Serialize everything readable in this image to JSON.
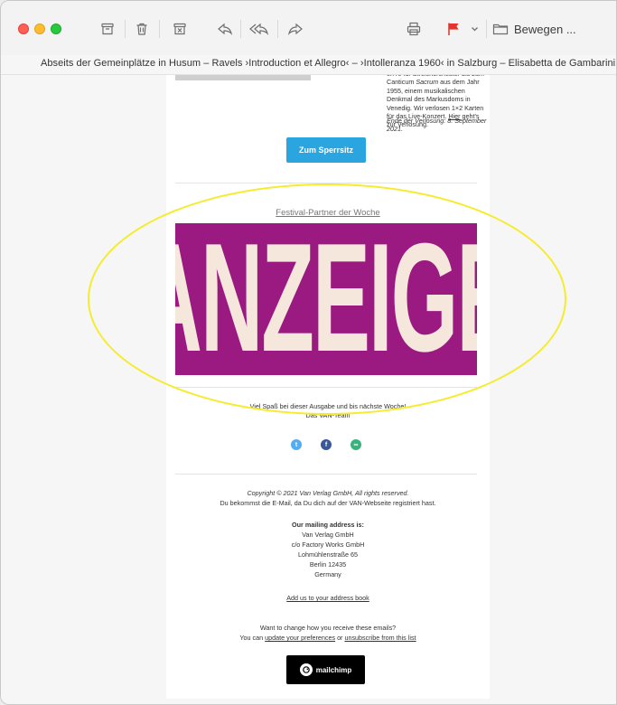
{
  "toolbar": {
    "move_label": "Bewegen ..."
  },
  "subject": "Abseits der Gemeinplätze in Husum – Ravels ›Introduction et Allegro‹ – ›Intolleranza 1960‹ in Salzburg – Elisabetta de Gambarini — Alle",
  "email": {
    "top_text_line1": "en ré für Streichorchester bis zum Canticum",
    "top_text_sacrum": "Sacrum",
    "top_text_line2": "aus dem Jahr 1955, einem musikalischen Denkmal des Markusdoms in Venedig. Wir verlosen 1×2 Karten für das Live-Konzert.",
    "top_text_link": "Hier",
    "top_text_line3": "geht's zur Verlosung.",
    "end_date": "Ende der Verlosung: 8. September 2021.",
    "cta_label": "Zum Sperrsitz",
    "partner_title": "Festival-Partner der Woche",
    "ad_text": "ANZEIGE",
    "greeting": "Viel Spaß bei dieser Ausgabe und bis nächste Woche!",
    "signature": "Das VAN-Team",
    "copyright": "Copyright © 2021 Van Verlag GmbH, All rights reserved.",
    "reason": "Du bekommst die E-Mail, da Du dich auf der VAN-Webseite registriert hast.",
    "address_heading": "Our mailing address is:",
    "address_lines": [
      "Van Verlag GmbH",
      "c/o Factory Works GmbH",
      "Lohmühlenstraße 65",
      "Berlin 12435",
      "Germany"
    ],
    "add_address_book": "Add us to your address book",
    "change_prompt": "Want to change how you receive these emails?",
    "you_can": "You can",
    "update_prefs": "update your preferences",
    "or": "or",
    "unsubscribe": "unsubscribe from this list",
    "mailchimp_label": "mailchimp"
  },
  "colors": {
    "cta": "#2aa5e0",
    "ad_background": "#9b1a82",
    "ad_text": "#f5e7db",
    "annotation": "#f4ec2c",
    "flag": "#e8322c"
  },
  "icons": [
    "archive-icon",
    "trash-icon",
    "junk-icon",
    "reply-icon",
    "reply-all-icon",
    "forward-icon",
    "print-icon",
    "flag-icon",
    "chevron-down-icon",
    "folder-icon",
    "twitter-icon",
    "facebook-icon",
    "website-icon",
    "mailchimp-logo-icon"
  ]
}
